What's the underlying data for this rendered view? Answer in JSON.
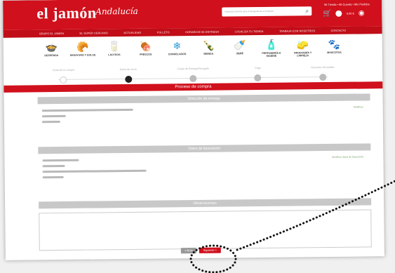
{
  "brand": {
    "logo_text": "el jamón",
    "logo_script": "Andalucía"
  },
  "search": {
    "placeholder": "Introduzca término para la búsqueda de un producto"
  },
  "header_links": {
    "line": "Mi Tienda • Mi Cuenta • Mis Pedidos",
    "cart_amount": "0,00 €"
  },
  "top_nav": [
    "GRUPO EL JAMÓN",
    "EL SÚPER CERCANO",
    "ACTUALIDAD",
    "FOLLETO",
    "HORARIOS DE ENTREGA",
    "LOCALIZA TU TIENDA",
    "TRABAJA CON NOSOTROS",
    "CONTACTO"
  ],
  "categories": [
    {
      "label": "DESPENSA",
      "icon": "pot-icon"
    },
    {
      "label": "DESAYUNO Y DULCE",
      "icon": "breakfast-icon"
    },
    {
      "label": "LÁCTEOS",
      "icon": "milk-icon"
    },
    {
      "label": "FRESCOS",
      "icon": "fresh-icon"
    },
    {
      "label": "CONGELADOS",
      "icon": "snowflake-icon"
    },
    {
      "label": "BEBIDA",
      "icon": "bottle-icon"
    },
    {
      "label": "BEBÉ",
      "icon": "baby-icon"
    },
    {
      "label": "PERFUMERÍA E HIGIENE",
      "icon": "perfume-icon"
    },
    {
      "label": "DROGUERÍA Y LIMPIEZA",
      "icon": "cleaning-icon"
    },
    {
      "label": "MASCOTAS",
      "icon": "paw-icon"
    }
  ],
  "steps": [
    {
      "label": "Cesta de la compra",
      "state": "done"
    },
    {
      "label": "Datos de envío",
      "state": "active"
    },
    {
      "label": "Franja de Entrega/Recogida",
      "state": "pending"
    },
    {
      "label": "Pago",
      "state": "pending"
    },
    {
      "label": "Resumen del pedido",
      "state": "pending"
    }
  ],
  "process_title": "Proceso de compra",
  "delivery": {
    "header": "Dirección de entrega",
    "modify": "Modificar"
  },
  "billing": {
    "header": "Datos de facturación",
    "modify": "Modificar datos de facturación"
  },
  "observations": {
    "header": "Observaciones"
  },
  "buttons": {
    "back": "< Atrás",
    "next": "Siguiente >"
  },
  "colors": {
    "brand_red": "#d0101c",
    "section_gray": "#c8c8c8",
    "link_green": "#7aa26c"
  }
}
